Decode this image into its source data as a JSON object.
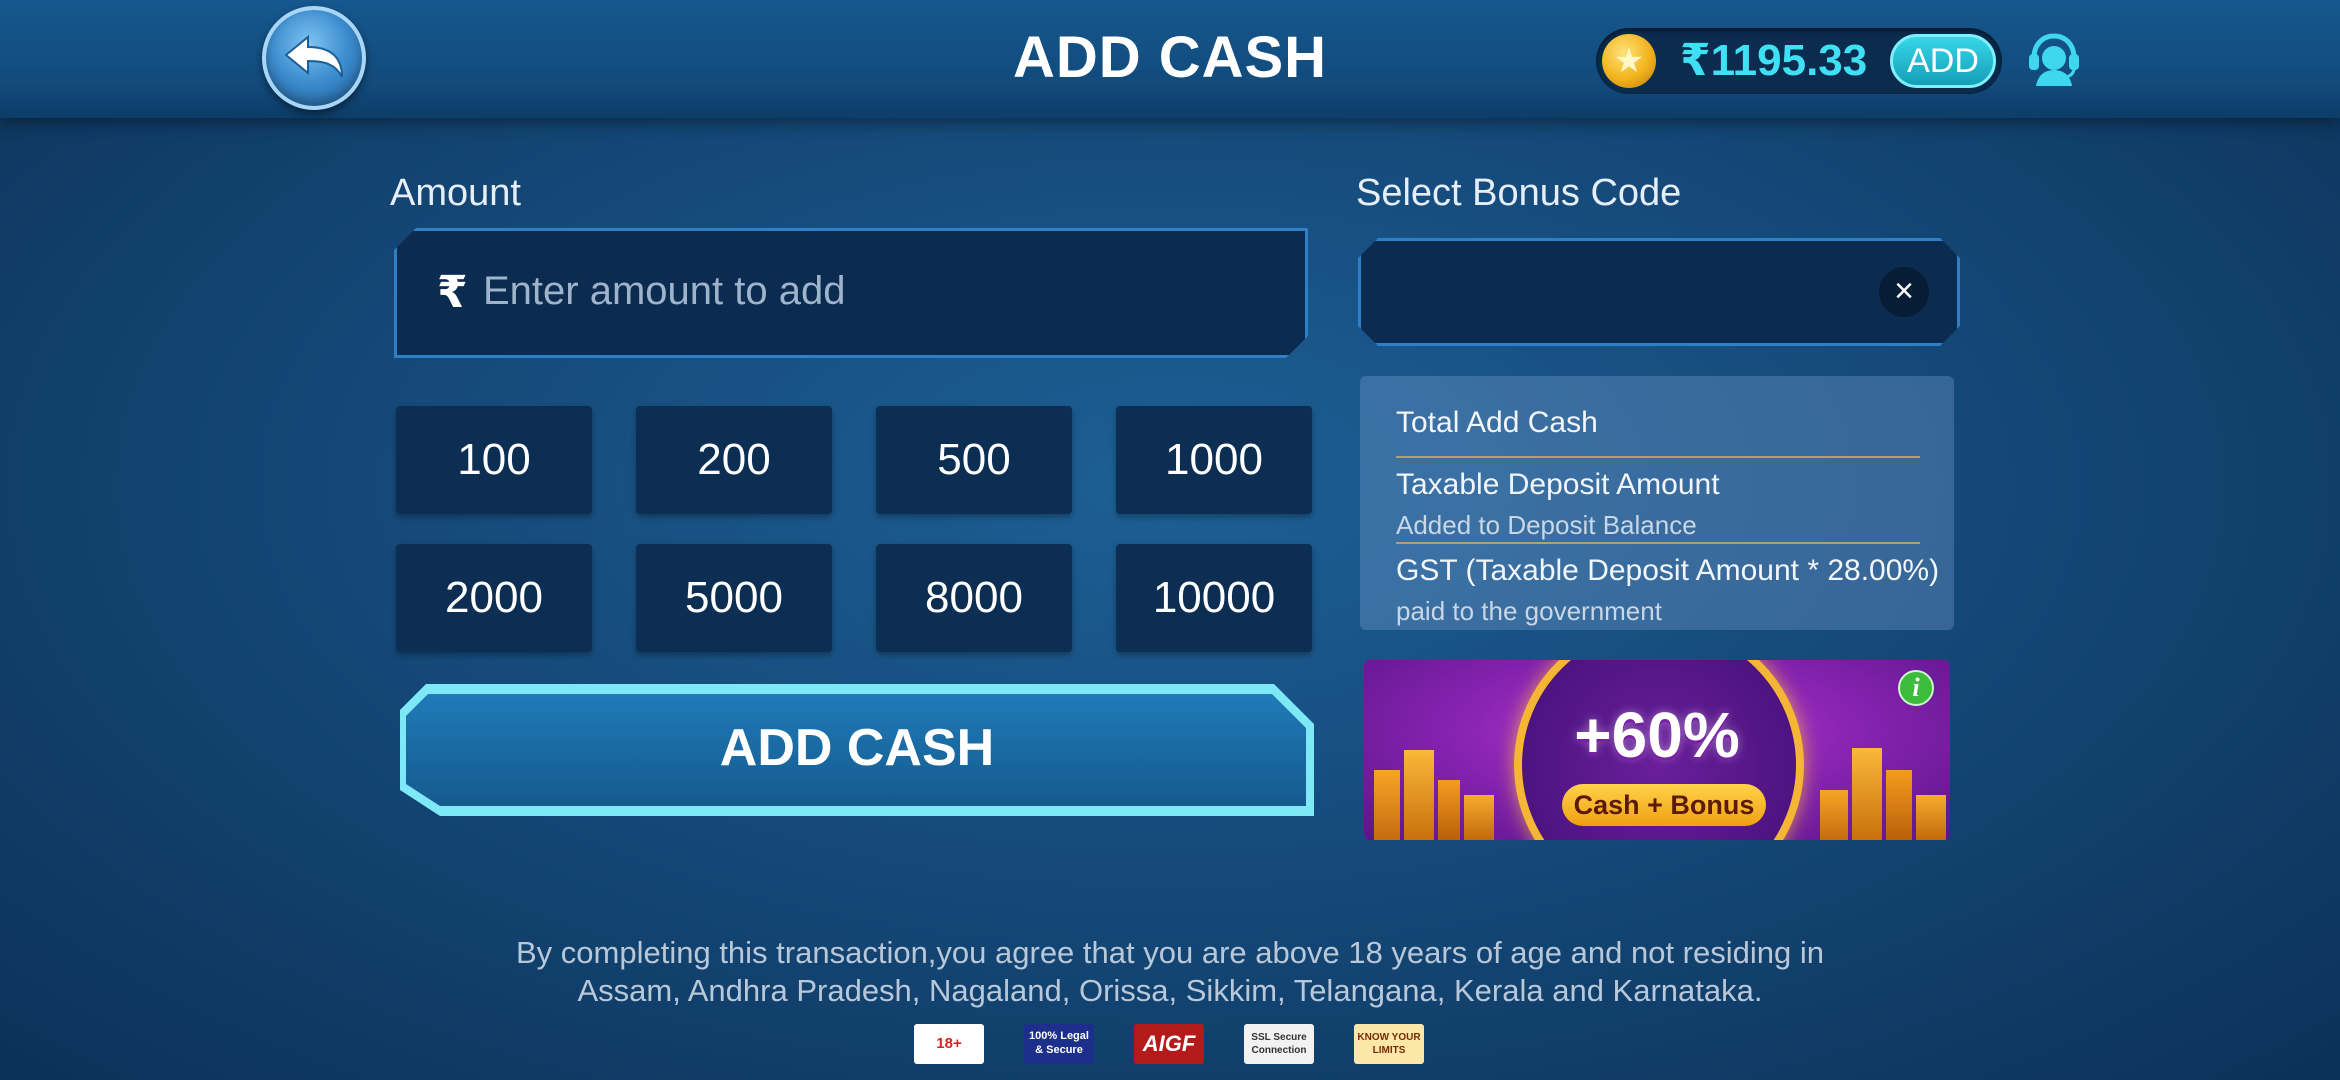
{
  "header": {
    "title": "ADD CASH",
    "balance": "₹1195.33",
    "add_label": "ADD"
  },
  "amount": {
    "label": "Amount",
    "currency_symbol": "₹",
    "placeholder": "Enter amount to add",
    "presets": [
      "100",
      "200",
      "500",
      "1000",
      "2000",
      "5000",
      "8000",
      "10000"
    ]
  },
  "add_cash_button": "ADD CASH",
  "bonus": {
    "label": "Select Bonus Code",
    "clear_symbol": "×"
  },
  "summary": {
    "total_label": "Total Add Cash",
    "taxable_label": "Taxable Deposit Amount",
    "taxable_sub": "Added to Deposit Balance",
    "gst_label": "GST (Taxable Deposit Amount * 28.00%)",
    "gst_sub": "paid to the government"
  },
  "promo": {
    "headline": "+60%",
    "tag": "Cash + Bonus",
    "info_symbol": "i"
  },
  "footer": {
    "disclaimer_line1": "By completing this transaction,you agree that you are above 18 years of age and not residing in",
    "disclaimer_line2": "Assam, Andhra Pradesh, Nagaland, Orissa, Sikkim, Telangana, Kerala and Karnataka.",
    "badges": [
      "18+",
      "100% Legal & Secure",
      "AIGF",
      "SSL Secure Connection",
      "KNOW YOUR LIMITS"
    ]
  },
  "icons": {
    "back": "back-arrow-icon",
    "coin": "coin-icon",
    "support": "headset-support-icon",
    "clear": "close-icon",
    "info": "info-icon"
  },
  "colors": {
    "accent_cyan": "#3fe0f4",
    "panel": "#0b2b50",
    "chip": "#0d2e53"
  }
}
